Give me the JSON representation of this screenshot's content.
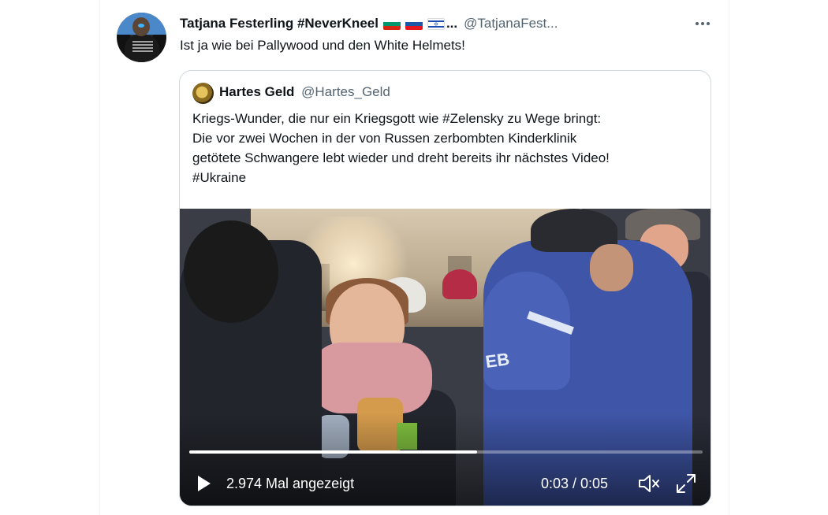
{
  "tweet": {
    "display_name": "Tatjana Festerling #NeverKneel",
    "flags": [
      "bulgaria-flag",
      "russia-flag",
      "israel-flag"
    ],
    "name_ellipsis": "...",
    "handle": "@TatjanaFest...",
    "text": "Ist ja wie bei Pallywood und den White Helmets!"
  },
  "quoted": {
    "display_name": "Hartes Geld",
    "handle": "@Hartes_Geld",
    "text_lines": [
      "Kriegs-Wunder, die nur ein Kriegsgott wie #Zelensky zu Wege bringt:",
      "Die vor zwei Wochen in der von Russen zerbombten Kinderklinik",
      "getötete Schwangere lebt wieder und dreht bereits ihr nächstes Video!",
      "#Ukraine"
    ],
    "video": {
      "views": "2.974 Mal angezeigt",
      "time": "0:03 / 0:05",
      "progress": 0.56,
      "jacket_text": "EB"
    }
  },
  "colors": {
    "text_primary": "#0f1419",
    "text_secondary": "#536471",
    "border": "#cfd9de"
  }
}
